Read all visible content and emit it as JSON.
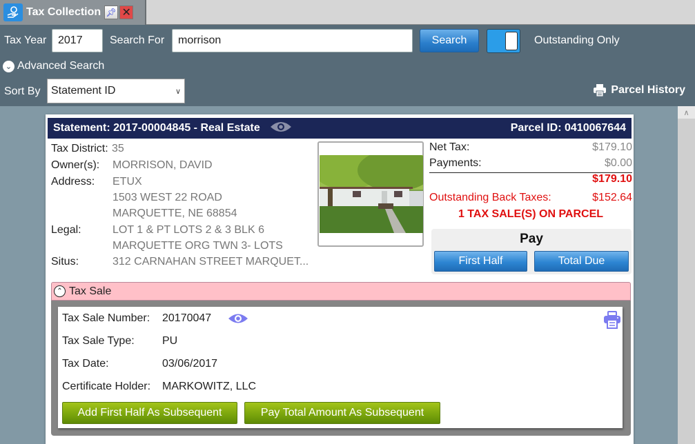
{
  "tab": {
    "title": "Tax Collection",
    "app_icon": "hand-coin-icon",
    "pin_icon": "pin-icon",
    "close_icon": "close-icon"
  },
  "search": {
    "tax_year_label": "Tax Year",
    "tax_year_value": "2017",
    "search_for_label": "Search For",
    "search_for_value": "morrison",
    "search_button": "Search",
    "outstanding_toggle_on": true,
    "outstanding_label": "Outstanding Only",
    "advanced_search_label": "Advanced Search",
    "sort_by_label": "Sort By",
    "sort_by_value": "Statement ID",
    "parcel_history_label": "Parcel History"
  },
  "statement": {
    "title": "Statement: 2017-00004845 - Real Estate",
    "parcel_id": "Parcel ID: 0410067644",
    "tax_district_label": "Tax District:",
    "tax_district": "35",
    "owners_label": "Owner(s):",
    "owners": "MORRISON, DAVID",
    "address_label": "Address:",
    "address_lines": [
      "ETUX",
      "1503 WEST 22 ROAD",
      "MARQUETTE, NE  68854"
    ],
    "legal_label": "Legal:",
    "legal_lines": [
      "LOT 1 & PT LOTS 2 & 3 BLK 6",
      "MARQUETTE   ORG TWN 3- LOTS"
    ],
    "situs_label": "Situs:",
    "situs": "312  CARNAHAN STREET MARQUET...",
    "photo_alt": "property-photo"
  },
  "financials": {
    "net_tax_label": "Net Tax:",
    "net_tax": "$179.10",
    "payments_label": "Payments:",
    "payments": "$0.00",
    "balance": "$179.10",
    "back_taxes_label": "Outstanding Back Taxes:",
    "back_taxes": "$152.64",
    "tax_sale_notice": "1 TAX SALE(S) ON PARCEL",
    "pay_title": "Pay",
    "first_half_button": "First Half",
    "total_due_button": "Total Due"
  },
  "tax_sale": {
    "section_title": "Tax Sale",
    "number_label": "Tax Sale Number:",
    "number": "20170047",
    "type_label": "Tax Sale Type:",
    "type": "PU",
    "date_label": "Tax Date:",
    "date": "03/06/2017",
    "holder_label": "Certificate Holder:",
    "holder": "MARKOWITZ, LLC",
    "add_first_half_button": "Add First Half As Subsequent",
    "pay_total_button": "Pay Total Amount As Subsequent"
  },
  "colors": {
    "header_navy": "#1b2657",
    "toolbar": "#576b78",
    "alert_red": "#e01010",
    "tax_sale_pink": "#ffc0c8",
    "action_green": "#78a30c",
    "action_blue": "#2d85d2",
    "eye_purple": "#7b7bf0"
  }
}
